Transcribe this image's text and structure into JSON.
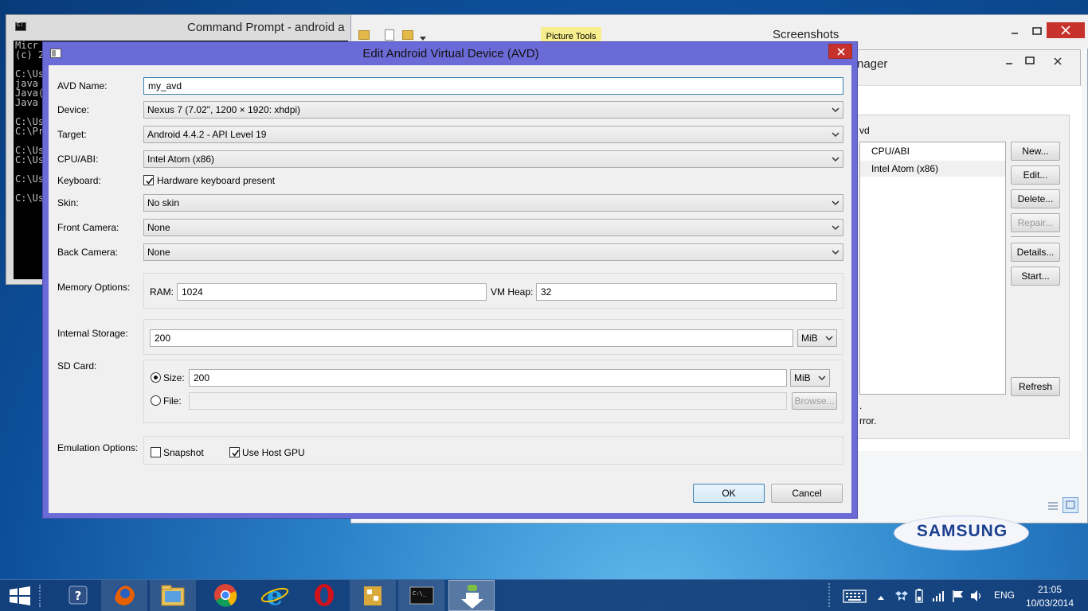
{
  "cmd_window": {
    "title": "Command Prompt - android  a",
    "lines": [
      "Micr",
      "(c) 2",
      "",
      "C:\\Us",
      "java ",
      "Java(",
      "Java ",
      "",
      "C:\\Us",
      "C:\\Pr",
      "",
      "C:\\Us",
      "C:\\Us",
      "",
      "C:\\Us",
      "",
      "C:\\Us"
    ]
  },
  "explorer_window": {
    "title": "Screenshots",
    "ribbon_context": "Picture Tools"
  },
  "avd_manager": {
    "title": "nager",
    "list_fragment": "vd",
    "column_header": "CPU/ABI",
    "row_value": "Intel Atom (x86)",
    "buttons": {
      "new": "New...",
      "edit": "Edit...",
      "delete": "Delete...",
      "repair": "Repair...",
      "details": "Details...",
      "start": "Start...",
      "refresh": "Refresh"
    },
    "footer_line1": ".",
    "footer_line2": "rror."
  },
  "dialog": {
    "title": "Edit Android Virtual Device (AVD)",
    "labels": {
      "avd_name": "AVD Name:",
      "device": "Device:",
      "target": "Target:",
      "cpu_abi": "CPU/ABI:",
      "keyboard": "Keyboard:",
      "skin": "Skin:",
      "front_camera": "Front Camera:",
      "back_camera": "Back Camera:",
      "memory_options": "Memory Options:",
      "ram": "RAM:",
      "vm_heap": "VM Heap:",
      "internal_storage": "Internal Storage:",
      "sd_card": "SD Card:",
      "size": "Size:",
      "file": "File:",
      "emulation_options": "Emulation Options:"
    },
    "values": {
      "avd_name": "my_avd",
      "device": "Nexus 7 (7.02\", 1200 × 1920: xhdpi)",
      "target": "Android 4.4.2 - API Level 19",
      "cpu_abi": "Intel Atom (x86)",
      "keyboard_option": "Hardware keyboard present",
      "keyboard_checked": true,
      "skin": "No skin",
      "front_camera": "None",
      "back_camera": "None",
      "ram": "1024",
      "vm_heap": "32",
      "internal_storage": "200",
      "internal_storage_unit": "MiB",
      "sd_size": "200",
      "sd_size_unit": "MiB",
      "sd_file": "",
      "sd_mode": "size",
      "snapshot_label": "Snapshot",
      "snapshot_checked": false,
      "host_gpu_label": "Use Host GPU",
      "host_gpu_checked": true
    },
    "buttons": {
      "browse": "Browse...",
      "ok": "OK",
      "cancel": "Cancel"
    }
  },
  "desktop": {
    "brand": "SAMSUNG"
  },
  "taskbar": {
    "language": "ENG",
    "time": "21:05",
    "date": "10/03/2014",
    "apps": [
      "help-icon",
      "firefox-icon",
      "file-explorer-icon",
      "chrome-icon",
      "internet-explorer-icon",
      "opera-icon",
      "tool-icon",
      "command-prompt-icon",
      "android-sdk-icon"
    ]
  },
  "colors": {
    "dialog_frame": "#6b6bd8",
    "close_button": "#c7322c",
    "taskbar": "#1b4f8c"
  }
}
